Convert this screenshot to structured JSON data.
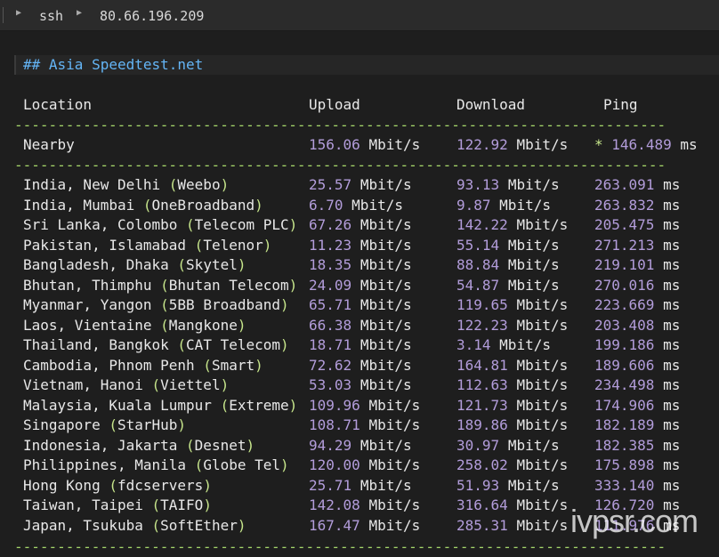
{
  "tab": {
    "path": [
      "ssh",
      "80.66.196.209"
    ]
  },
  "terminal": {
    "heading": "## Asia Speedtest.net",
    "columns": [
      "Location",
      "Upload",
      "Download",
      "Ping"
    ],
    "separator": "--------------------------------------------------------------------------------------------------",
    "nearby": {
      "location": "Nearby",
      "upload_value": "156.06",
      "upload_unit": "Mbit/s",
      "download_value": "122.92",
      "download_unit": "Mbit/s",
      "ping_marker": "*",
      "ping_value": "146.489",
      "ping_unit": "ms"
    },
    "rows": [
      {
        "place": "India, New Delhi",
        "isp": "Weebo",
        "upload": "25.57",
        "download": "93.13",
        "ping": "263.091"
      },
      {
        "place": "India, Mumbai",
        "isp": "OneBroadband",
        "upload": "6.70",
        "download": "9.87",
        "ping": "263.832"
      },
      {
        "place": "Sri Lanka, Colombo",
        "isp": "Telecom PLC",
        "upload": "67.26",
        "download": "142.22",
        "ping": "205.475"
      },
      {
        "place": "Pakistan, Islamabad",
        "isp": "Telenor",
        "upload": "11.23",
        "download": "55.14",
        "ping": "271.213"
      },
      {
        "place": "Bangladesh, Dhaka",
        "isp": "Skytel",
        "upload": "18.35",
        "download": "88.84",
        "ping": "219.101"
      },
      {
        "place": "Bhutan, Thimphu",
        "isp": "Bhutan Telecom",
        "upload": "24.09",
        "download": "54.87",
        "ping": "270.016"
      },
      {
        "place": "Myanmar, Yangon",
        "isp": "5BB Broadband",
        "upload": "65.71",
        "download": "119.65",
        "ping": "223.669"
      },
      {
        "place": "Laos, Vientaine",
        "isp": "Mangkone",
        "upload": "66.38",
        "download": "122.23",
        "ping": "203.408"
      },
      {
        "place": "Thailand, Bangkok",
        "isp": "CAT Telecom",
        "upload": "18.71",
        "download": "3.14",
        "ping": "199.186"
      },
      {
        "place": "Cambodia, Phnom Penh",
        "isp": "Smart",
        "upload": "72.62",
        "download": "164.81",
        "ping": "189.606"
      },
      {
        "place": "Vietnam, Hanoi",
        "isp": "Viettel",
        "upload": "53.03",
        "download": "112.63",
        "ping": "234.498"
      },
      {
        "place": "Malaysia, Kuala Lumpur",
        "isp": "Extreme",
        "upload": "109.96",
        "download": "121.73",
        "ping": "174.906"
      },
      {
        "place": "Singapore",
        "isp": "StarHub",
        "upload": "108.71",
        "download": "189.86",
        "ping": "182.189"
      },
      {
        "place": "Indonesia, Jakarta",
        "isp": "Desnet",
        "upload": "94.29",
        "download": "30.97",
        "ping": "182.385"
      },
      {
        "place": "Philippines, Manila",
        "isp": "Globe Tel",
        "upload": "120.00",
        "download": "258.02",
        "ping": "175.898"
      },
      {
        "place": "Hong Kong",
        "isp": "fdcservers",
        "upload": "25.71",
        "download": "51.93",
        "ping": "333.140"
      },
      {
        "place": "Taiwan, Taipei",
        "isp": "TAIFO",
        "upload": "142.08",
        "download": "316.64",
        "ping": "126.720"
      },
      {
        "place": "Japan, Tsukuba",
        "isp": "SoftEther",
        "upload": "167.47",
        "download": "285.31",
        "ping": "111.976"
      }
    ],
    "units": {
      "speed": "Mbit/s",
      "ping": "ms"
    }
  },
  "watermark": "ivpsr.com",
  "colors": {
    "background": "#1e1e1e",
    "number": "#b39ddb",
    "paren": "#c6e58b",
    "separator": "#a5d66a",
    "heading": "#64b5f6"
  }
}
